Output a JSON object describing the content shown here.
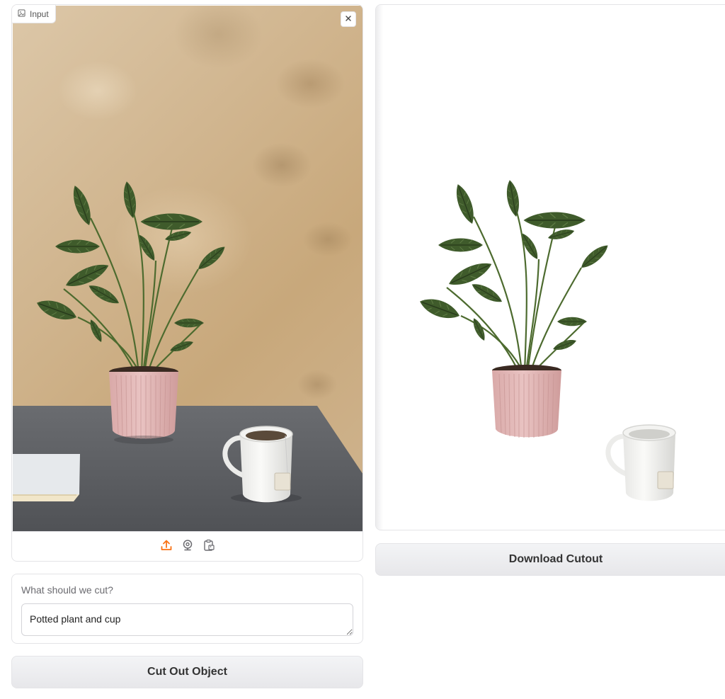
{
  "input_panel": {
    "label": "Input",
    "label_icon": "image-icon",
    "close_icon": "close-icon",
    "source_icons": [
      "upload-icon",
      "webcam-icon",
      "clipboard-icon"
    ],
    "accent_color": "#f97316"
  },
  "prompt": {
    "label": "What should we cut?",
    "value": "Potted plant and cup"
  },
  "buttons": {
    "cut_label": "Cut Out Object",
    "download_label": "Download Cutout"
  },
  "colors": {
    "wall": "#d1b690",
    "table": "#5d5f63",
    "pot": "#e2b8b7",
    "leaf": "#3d5a2a",
    "button_bg": "#eeeef0"
  }
}
